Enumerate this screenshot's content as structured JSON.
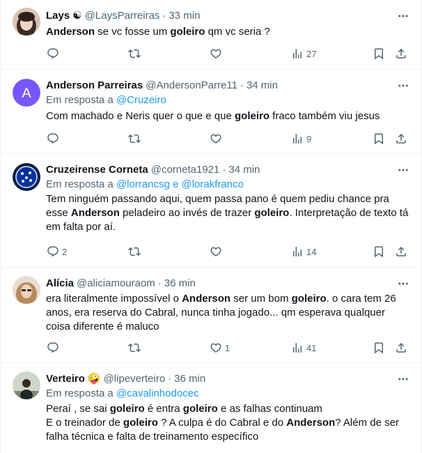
{
  "tweets": [
    {
      "name": "Lays",
      "name_suffix": "☯",
      "handle": "@LaysParreiras",
      "time": "33 min",
      "reply_to_prefix": "",
      "reply_to": "",
      "text_html": "<b>Anderson</b> se vc fosse um <b>goleiro</b> qm vc seria ?",
      "replies": "",
      "retweets": "",
      "likes": "",
      "views": "27",
      "avatar_icon": "user-photo-avatar"
    },
    {
      "name": "Anderson Parreiras",
      "name_suffix": "",
      "handle": "@AndersonParre11",
      "time": "34 min",
      "reply_to_prefix": "Em resposta a",
      "reply_to": "@Cruzeiro",
      "text_html": "Com machado e Neris quer o que e que <b>goleiro</b> fraco também viu jesus",
      "replies": "",
      "retweets": "",
      "likes": "",
      "views": "9",
      "avatar_letter": "A",
      "avatar_color": "#7856ff"
    },
    {
      "name": "Cruzeirense Corneta",
      "name_suffix": "",
      "handle": "@corneta1921",
      "time": "34 min",
      "reply_to_prefix": "Em resposta a",
      "reply_to": "@lorrancsg e @lorakfranco",
      "text_html": "Tem ninguém passando aqui, quem passa pano é quem pediu chance pra esse <b>Anderson</b> peladeiro ao invés de trazer <b>goleiro</b>. Interpretação de texto tá em falta por aí.",
      "replies": "2",
      "retweets": "",
      "likes": "",
      "views": "14",
      "avatar_icon": "cruzeiro-crest-avatar"
    },
    {
      "name": "Alícia",
      "name_suffix": "",
      "handle": "@aliciamouraom",
      "time": "36 min",
      "reply_to_prefix": "",
      "reply_to": "",
      "text_html": "era literalmente impossível o <b>Anderson</b> ser um bom <b>goleiro</b>. o cara tem 26 anos, era reserva do Cabral, nunca tinha jogado... qm esperava qualquer coisa diferente é maluco",
      "replies": "",
      "retweets": "",
      "likes": "1",
      "views": "41",
      "avatar_icon": "user-photo-avatar"
    },
    {
      "name": "Verteiro",
      "name_suffix": "🤪",
      "handle": "@lipeverteiro",
      "time": "36 min",
      "reply_to_prefix": "Em resposta a",
      "reply_to": "@cavalinhodocec",
      "text_html": "Peraí , se sai <b>goleiro</b> é entra <b>goleiro</b> e as falhas continuam<br>E o treinador de <b>goleiro</b> ? A culpa é do Cabral e do <b>Anderson</b>? Além de ser falha técnica e falta de treinamento específico",
      "replies": "",
      "retweets": "",
      "likes": "",
      "views": "",
      "avatar_icon": "user-photo-avatar"
    }
  ],
  "colors": {
    "accent": "#1d9bf0",
    "muted": "#536471",
    "divider": "#eff3f4"
  }
}
